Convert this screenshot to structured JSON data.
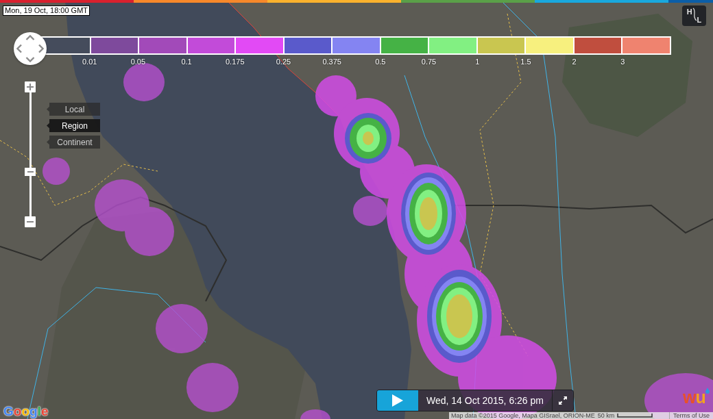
{
  "forecast_time": "Mon, 19 Oct, 18:00 GMT",
  "legend": {
    "swatches": [
      {
        "color": "#454c5c"
      },
      {
        "color": "#7e4a9c"
      },
      {
        "color": "#a24ab9"
      },
      {
        "color": "#c24bd9"
      },
      {
        "color": "#e24af5"
      },
      {
        "color": "#5a5acb"
      },
      {
        "color": "#8484f2"
      },
      {
        "color": "#45b245"
      },
      {
        "color": "#82f082"
      },
      {
        "color": "#c9c650"
      },
      {
        "color": "#f7f07e"
      },
      {
        "color": "#c04e3e"
      },
      {
        "color": "#ef836f"
      }
    ],
    "ticks": [
      "0.01",
      "0.05",
      "0.1",
      "0.175",
      "0.25",
      "0.375",
      "0.5",
      "0.75",
      "1",
      "1.5",
      "2",
      "3"
    ]
  },
  "zoom": {
    "level": 0.35
  },
  "zoom_levels": [
    {
      "label": "Local",
      "selected": false
    },
    {
      "label": "Region",
      "selected": true
    },
    {
      "label": "Continent",
      "selected": false
    }
  ],
  "layer_toggle": {
    "left": "H",
    "right": "L"
  },
  "player": {
    "playing": false,
    "date": "Wed, 14 Oct 2015, 6:26 pm"
  },
  "brand_logo": "wu",
  "google_logo": "Google",
  "attribution": {
    "map_data": "Map data ©2015 Google, Mapa GISrael, ORION-ME",
    "scale": "50 km",
    "terms": "Terms of Use"
  }
}
